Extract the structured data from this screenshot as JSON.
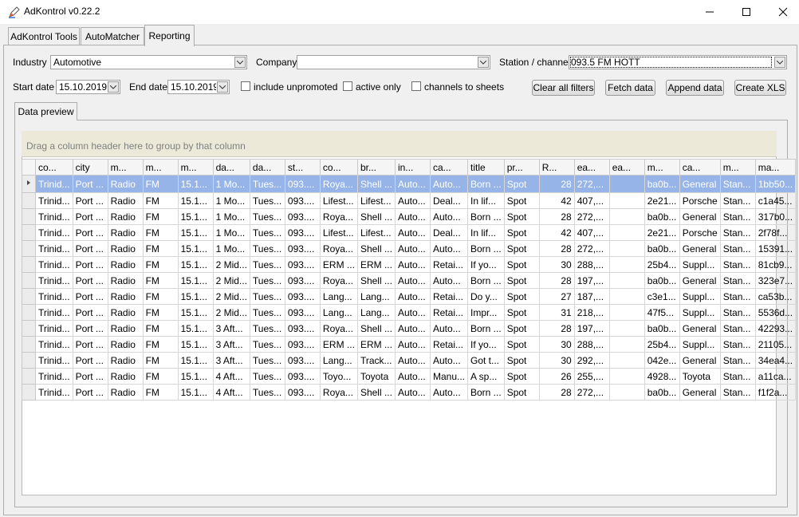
{
  "window": {
    "title": "AdKontrol v0.22.2"
  },
  "tabs": [
    "AdKontrol Tools",
    "AutoMatcher",
    "Reporting"
  ],
  "filters": {
    "industry_label": "Industry",
    "industry_value": "Automotive",
    "company_label": "Company",
    "company_value": "",
    "station_label": "Station / channel",
    "station_value": "093.5 FM HOTT",
    "start_label": "Start date",
    "start_value": "15.10.2019.",
    "end_label": "End date",
    "end_value": "15.10.2019",
    "chk_unpromoted": "include unpromoted",
    "chk_active": "active only",
    "chk_sheets": "channels to sheets"
  },
  "buttons": {
    "clear": "Clear all filters",
    "fetch": "Fetch data",
    "append": "Append data",
    "create": "Create XLS"
  },
  "preview_tab": "Data preview",
  "group_hint": "Drag a column header here to group by that column",
  "columns": [
    "co...",
    "city",
    "m...",
    "m...",
    "m...",
    "da...",
    "da...",
    "st...",
    "co...",
    "br...",
    "in...",
    "ca...",
    "title",
    "pr...",
    "R...",
    "ea...",
    "ea...",
    "m...",
    "ca...",
    "m...",
    "ma..."
  ],
  "rows": [
    [
      "Trinid...",
      "Port ...",
      "Radio",
      "FM",
      "15.1...",
      "1 Mo...",
      "Tues...",
      "093....",
      "Roya...",
      "Shell ...",
      "Auto...",
      "Auto...",
      "Born ...",
      "Spot",
      "28",
      "272,...",
      "",
      "ba0b...",
      "General",
      "Stan...",
      "1bb50..."
    ],
    [
      "Trinid...",
      "Port ...",
      "Radio",
      "FM",
      "15.1...",
      "1 Mo...",
      "Tues...",
      "093....",
      "Lifest...",
      "Lifest...",
      "Auto...",
      "Deal...",
      "In lif...",
      "Spot",
      "42",
      "407,...",
      "",
      "2e21...",
      "Porsche",
      "Stan...",
      "c1a45..."
    ],
    [
      "Trinid...",
      "Port ...",
      "Radio",
      "FM",
      "15.1...",
      "1 Mo...",
      "Tues...",
      "093....",
      "Roya...",
      "Shell ...",
      "Auto...",
      "Auto...",
      "Born ...",
      "Spot",
      "28",
      "272,...",
      "",
      "ba0b...",
      "General",
      "Stan...",
      "317b0..."
    ],
    [
      "Trinid...",
      "Port ...",
      "Radio",
      "FM",
      "15.1...",
      "1 Mo...",
      "Tues...",
      "093....",
      "Lifest...",
      "Lifest...",
      "Auto...",
      "Deal...",
      "In lif...",
      "Spot",
      "42",
      "407,...",
      "",
      "2e21...",
      "Porsche",
      "Stan...",
      "2f78f..."
    ],
    [
      "Trinid...",
      "Port ...",
      "Radio",
      "FM",
      "15.1...",
      "1 Mo...",
      "Tues...",
      "093....",
      "Roya...",
      "Shell ...",
      "Auto...",
      "Auto...",
      "Born ...",
      "Spot",
      "28",
      "272,...",
      "",
      "ba0b...",
      "General",
      "Stan...",
      "15391..."
    ],
    [
      "Trinid...",
      "Port ...",
      "Radio",
      "FM",
      "15.1...",
      "2 Mid...",
      "Tues...",
      "093....",
      "ERM ...",
      "ERM ...",
      "Auto...",
      "Retai...",
      "If yo...",
      "Spot",
      "30",
      "288,...",
      "",
      "25b4...",
      "Suppl...",
      "Stan...",
      "81cb9..."
    ],
    [
      "Trinid...",
      "Port ...",
      "Radio",
      "FM",
      "15.1...",
      "2 Mid...",
      "Tues...",
      "093....",
      "Roya...",
      "Shell ...",
      "Auto...",
      "Auto...",
      "Born ...",
      "Spot",
      "28",
      "197,...",
      "",
      "ba0b...",
      "General",
      "Stan...",
      "323e7..."
    ],
    [
      "Trinid...",
      "Port ...",
      "Radio",
      "FM",
      "15.1...",
      "2 Mid...",
      "Tues...",
      "093....",
      "Lang...",
      "Lang...",
      "Auto...",
      "Retai...",
      "Do y...",
      "Spot",
      "27",
      "187,...",
      "",
      "c3e1...",
      "Suppl...",
      "Stan...",
      "ca53b..."
    ],
    [
      "Trinid...",
      "Port ...",
      "Radio",
      "FM",
      "15.1...",
      "2 Mid...",
      "Tues...",
      "093....",
      "Lang...",
      "Lang...",
      "Auto...",
      "Retai...",
      "Impr...",
      "Spot",
      "31",
      "218,...",
      "",
      "47f5...",
      "Suppl...",
      "Stan...",
      "5536d..."
    ],
    [
      "Trinid...",
      "Port ...",
      "Radio",
      "FM",
      "15.1...",
      "3 Aft...",
      "Tues...",
      "093....",
      "Roya...",
      "Shell ...",
      "Auto...",
      "Auto...",
      "Born ...",
      "Spot",
      "28",
      "197,...",
      "",
      "ba0b...",
      "General",
      "Stan...",
      "42293..."
    ],
    [
      "Trinid...",
      "Port ...",
      "Radio",
      "FM",
      "15.1...",
      "3 Aft...",
      "Tues...",
      "093....",
      "ERM ...",
      "ERM ...",
      "Auto...",
      "Retai...",
      "If yo...",
      "Spot",
      "30",
      "288,...",
      "",
      "25b4...",
      "Suppl...",
      "Stan...",
      "21105..."
    ],
    [
      "Trinid...",
      "Port ...",
      "Radio",
      "FM",
      "15.1...",
      "3 Aft...",
      "Tues...",
      "093....",
      "Lang...",
      "Track...",
      "Auto...",
      "Auto...",
      "Got t...",
      "Spot",
      "30",
      "292,...",
      "",
      "042e...",
      "General",
      "Stan...",
      "34ea4..."
    ],
    [
      "Trinid...",
      "Port ...",
      "Radio",
      "FM",
      "15.1...",
      "4 Aft...",
      "Tues...",
      "093....",
      "Toyo...",
      "Toyota",
      "Auto...",
      "Manu...",
      "A sp...",
      "Spot",
      "26",
      "255,...",
      "",
      "4928...",
      "Toyota",
      "Stan...",
      "a11ca..."
    ],
    [
      "Trinid...",
      "Port ...",
      "Radio",
      "FM",
      "15.1...",
      "4 Aft...",
      "Tues...",
      "093....",
      "Roya...",
      "Shell ...",
      "Auto...",
      "Auto...",
      "Born ...",
      "Spot",
      "28",
      "272,...",
      "",
      "ba0b...",
      "General",
      "Stan...",
      "f1f2a..."
    ]
  ],
  "colors": {
    "selection": "#97b4e8",
    "group_area": "#ece9d8"
  }
}
